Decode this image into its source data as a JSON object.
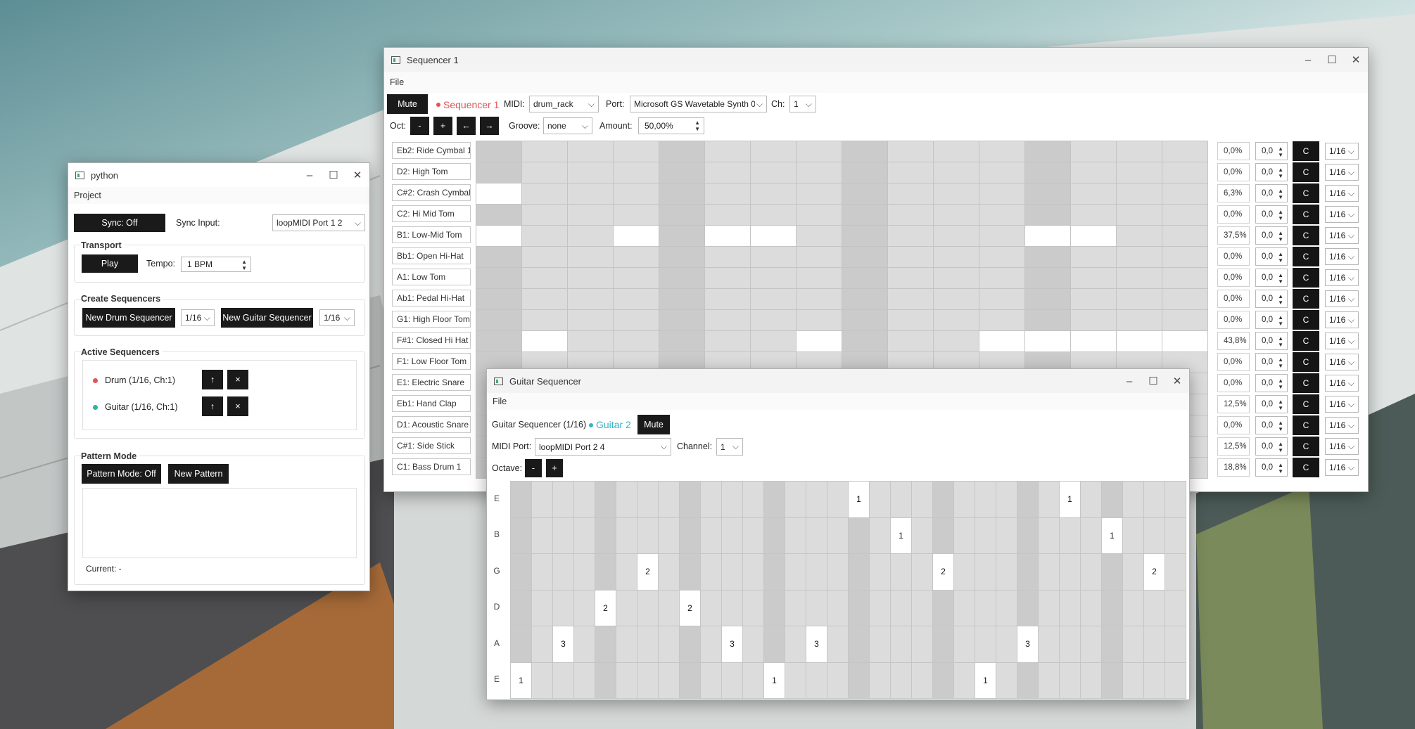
{
  "desktop": {
    "colors": {
      "sky": "#6e9ea3",
      "building": "#d8dcdb"
    }
  },
  "python": {
    "title": "python",
    "menu": "Project",
    "sync": {
      "button": "Sync: Off",
      "input_label": "Sync Input:",
      "port": "loopMIDI Port 1 2"
    },
    "transport": {
      "title": "Transport",
      "play": "Play",
      "tempo_label": "Tempo:",
      "tempo": "1 BPM"
    },
    "create": {
      "title": "Create Sequencers",
      "drum_button": "New Drum Sequencer",
      "drum_res": "1/16",
      "guitar_button": "New Guitar Sequencer",
      "guitar_res": "1/16"
    },
    "active": {
      "title": "Active Sequencers",
      "items": [
        {
          "label": "Drum (1/16, Ch:1)",
          "color": "#e05555",
          "up": "↑",
          "remove": "×"
        },
        {
          "label": "Guitar (1/16, Ch:1)",
          "color": "#2bb5a0",
          "up": "↑",
          "remove": "×"
        }
      ]
    },
    "pattern": {
      "title": "Pattern Mode",
      "toggle": "Pattern Mode: Off",
      "new_button": "New Pattern",
      "current": "Current: -"
    }
  },
  "seq": {
    "title": "Sequencer 1",
    "menu": "File",
    "mute": "Mute",
    "name": "Sequencer 1",
    "name_color": "#e05555",
    "midi_label": "MIDI:",
    "midi": "drum_rack",
    "port_label": "Port:",
    "port": "Microsoft GS Wavetable Synth 0",
    "ch_label": "Ch:",
    "ch": "1",
    "oct_label": "Oct:",
    "oct_buttons": [
      "-",
      "+",
      "←",
      "→"
    ],
    "groove_label": "Groove:",
    "groove": "none",
    "amount_label": "Amount:",
    "amount": "50,00%",
    "tracks": [
      "Eb2: Ride Cymbal 1",
      "D2: High Tom",
      "C#2: Crash Cymbal 1",
      "C2: Hi Mid Tom",
      "B1: Low-Mid Tom",
      "Bb1: Open Hi-Hat",
      "A1: Low Tom",
      "Ab1: Pedal Hi-Hat",
      "G1: High Floor Tom",
      "F#1: Closed Hi Hat",
      "F1: Low Floor Tom",
      "E1: Electric Snare",
      "Eb1: Hand Clap",
      "D1: Acoustic Snare",
      "C#1: Side Stick",
      "C1: Bass Drum 1"
    ],
    "pcts": [
      "0,0%",
      "0,0%",
      "6,3%",
      "0,0%",
      "37,5%",
      "0,0%",
      "0,0%",
      "0,0%",
      "0,0%",
      "43,8%",
      "0,0%",
      "0,0%",
      "12,5%",
      "0,0%",
      "12,5%",
      "18,8%"
    ],
    "vals": [
      "0,0",
      "0,0",
      "0,0",
      "0,0",
      "0,0",
      "0,0",
      "0,0",
      "0,0",
      "0,0",
      "0,0",
      "0,0",
      "0,0",
      "0,0",
      "0,0",
      "0,0",
      "0,0"
    ],
    "key": "C",
    "res": "1/16",
    "active_steps": [
      [],
      [],
      [
        0
      ],
      [],
      [
        0,
        3,
        5,
        6,
        12,
        13
      ],
      [],
      [],
      [],
      [],
      [
        1,
        7,
        11,
        12,
        13,
        14,
        15
      ],
      [],
      [],
      [],
      [],
      [],
      []
    ]
  },
  "guitar": {
    "title": "Guitar Sequencer",
    "menu": "File",
    "name": "Guitar Sequencer (1/16)",
    "badge": "Guitar 2",
    "badge_color": "#33b3c6",
    "mute": "Mute",
    "port_label": "MIDI Port:",
    "port": "loopMIDI Port 2 4",
    "channel_label": "Channel:",
    "channel": "1",
    "octave_label": "Octave:",
    "octave_buttons": [
      "-",
      "+"
    ],
    "strings": [
      "E",
      "B",
      "G",
      "D",
      "A",
      "E"
    ],
    "notes": [
      [
        [
          16,
          "1"
        ],
        [
          26,
          "1"
        ]
      ],
      [
        [
          18,
          "1"
        ],
        [
          28,
          "1"
        ]
      ],
      [
        [
          6,
          "2"
        ],
        [
          20,
          "2"
        ],
        [
          30,
          "2"
        ]
      ],
      [
        [
          4,
          "2"
        ],
        [
          8,
          "2"
        ]
      ],
      [
        [
          2,
          "3"
        ],
        [
          10,
          "3"
        ],
        [
          14,
          "3"
        ],
        [
          24,
          "3"
        ]
      ],
      [
        [
          0,
          "1"
        ],
        [
          12,
          "1"
        ],
        [
          22,
          "1"
        ]
      ]
    ]
  }
}
